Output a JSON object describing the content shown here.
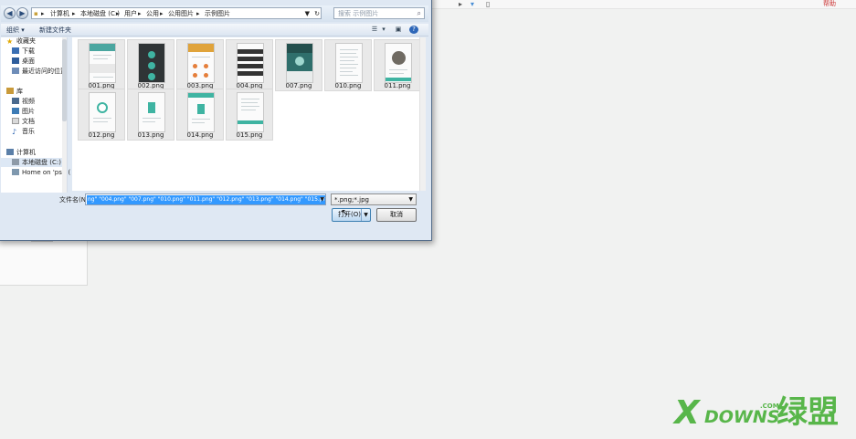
{
  "background": {
    "help_label": "帮助",
    "toolbar_icons": [
      "flag-icon",
      "dropdown-arrow-icon",
      "page-icon"
    ]
  },
  "dialog": {
    "breadcrumb": [
      "计算机",
      "本地磁盘 (C:)",
      "用户",
      "公用",
      "公用图片",
      "示例图片"
    ],
    "search_placeholder": "搜索 示例图片",
    "toolbar": {
      "organize_label": "组织 ▾",
      "new_folder_label": "新建文件夹"
    },
    "sidebar": [
      {
        "label": "收藏夹",
        "icon": "star-icon"
      },
      {
        "label": "下载",
        "icon": "download-folder-icon"
      },
      {
        "label": "桌面",
        "icon": "desktop-icon"
      },
      {
        "label": "最近访问的位置",
        "icon": "recent-places-icon"
      },
      {
        "label": "库",
        "icon": "library-icon"
      },
      {
        "label": "视频",
        "icon": "video-icon"
      },
      {
        "label": "图片",
        "icon": "pictures-icon"
      },
      {
        "label": "文档",
        "icon": "documents-icon"
      },
      {
        "label": "音乐",
        "icon": "music-icon"
      },
      {
        "label": "计算机",
        "icon": "computer-icon"
      },
      {
        "label": "本地磁盘 (C:)",
        "icon": "drive-icon"
      },
      {
        "label": "Home on 'psf' (",
        "icon": "network-drive-icon"
      }
    ],
    "files": [
      {
        "name": "001.png"
      },
      {
        "name": "002.png"
      },
      {
        "name": "003.png"
      },
      {
        "name": "004.png"
      },
      {
        "name": "007.png"
      },
      {
        "name": "010.png"
      },
      {
        "name": "011.png"
      },
      {
        "name": "012.png"
      },
      {
        "name": "013.png"
      },
      {
        "name": "014.png"
      },
      {
        "name": "015.png"
      }
    ],
    "filename_label": "文件名(N):",
    "filename_value": "ng\" \"004.png\" \"007.png\" \"010.png\" \"011.png\" \"012.png\" \"013.png\" \"014.png\" \"015.png\"",
    "filetype_value": "*.png;*.jpg",
    "open_label": "打开(O)",
    "cancel_label": "取消"
  },
  "watermark": {
    "brand_x": "X",
    "brand_text": "DOWNS",
    "brand_com": ".COM",
    "brand_cn": "绿盟"
  }
}
